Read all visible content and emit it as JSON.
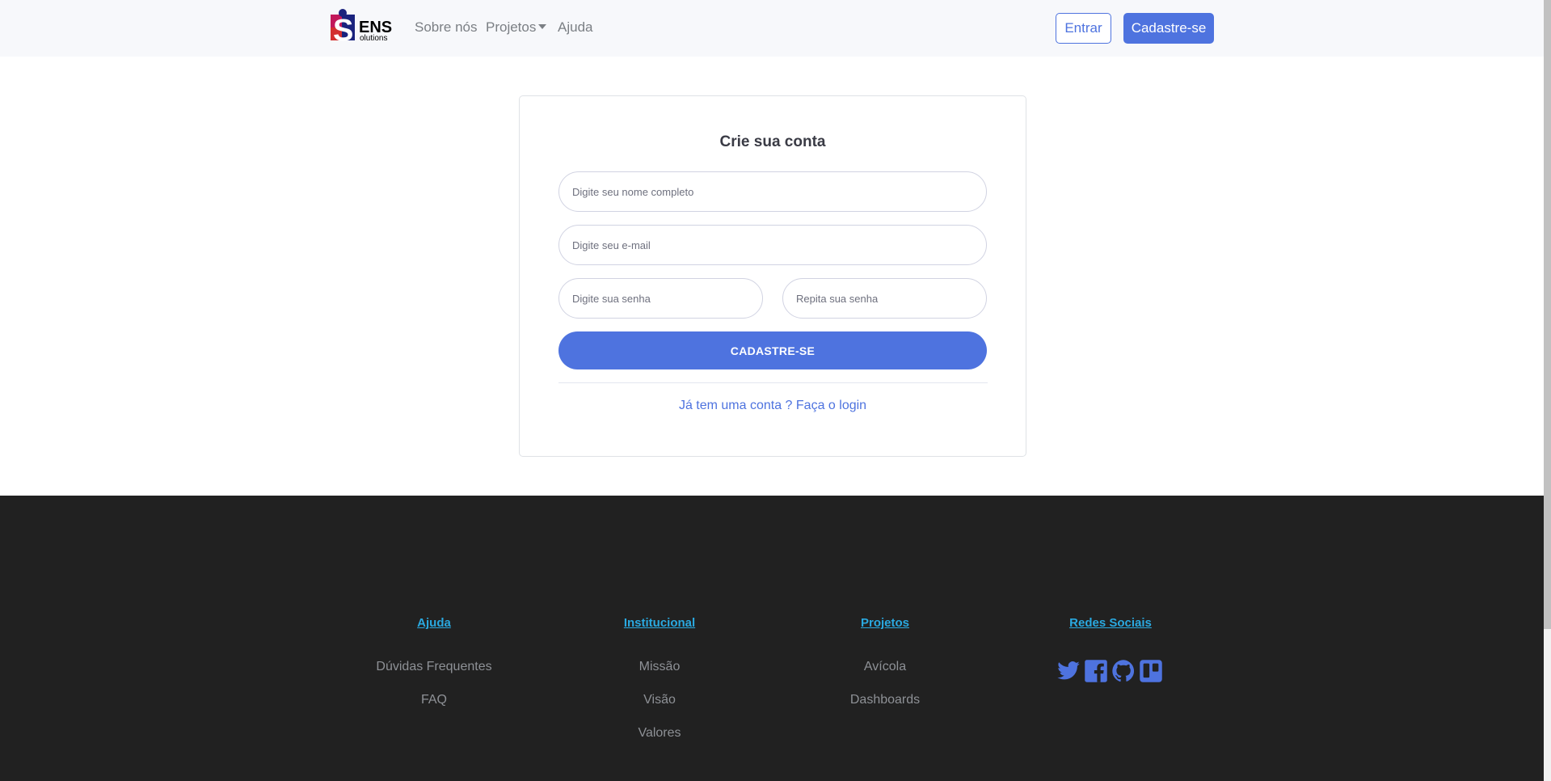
{
  "nav": {
    "logo_text": "ENS",
    "logo_sub": "olutions",
    "logo_letter": "S",
    "links": [
      "Sobre nós",
      "Projetos",
      "Ajuda"
    ],
    "login_label": "Entrar",
    "signup_label": "Cadastre-se"
  },
  "form": {
    "title": "Crie sua conta",
    "name_placeholder": "Digite seu nome completo",
    "email_placeholder": "Digite seu e-mail",
    "password_placeholder": "Digite sua senha",
    "repeat_placeholder": "Repita sua senha",
    "submit_label": "CADASTRE-SE",
    "login_prompt": "Já tem uma conta ? Faça o login"
  },
  "footer": {
    "columns": [
      {
        "heading": "Ajuda",
        "items": [
          "Dúvidas Frequentes",
          "FAQ"
        ]
      },
      {
        "heading": "Institucional",
        "items": [
          "Missão",
          "Visão",
          "Valores"
        ]
      },
      {
        "heading": "Projetos",
        "items": [
          "Avícola",
          "Dashboards"
        ]
      },
      {
        "heading": "Redes Sociais",
        "items": []
      }
    ],
    "social_icons": [
      "twitter-icon",
      "facebook-icon",
      "github-icon",
      "trello-icon"
    ]
  },
  "colors": {
    "primary": "#4e73df",
    "footer_bg": "#212121",
    "footer_heading": "#2aa9e0",
    "navbar_bg": "#f7f8fb"
  }
}
